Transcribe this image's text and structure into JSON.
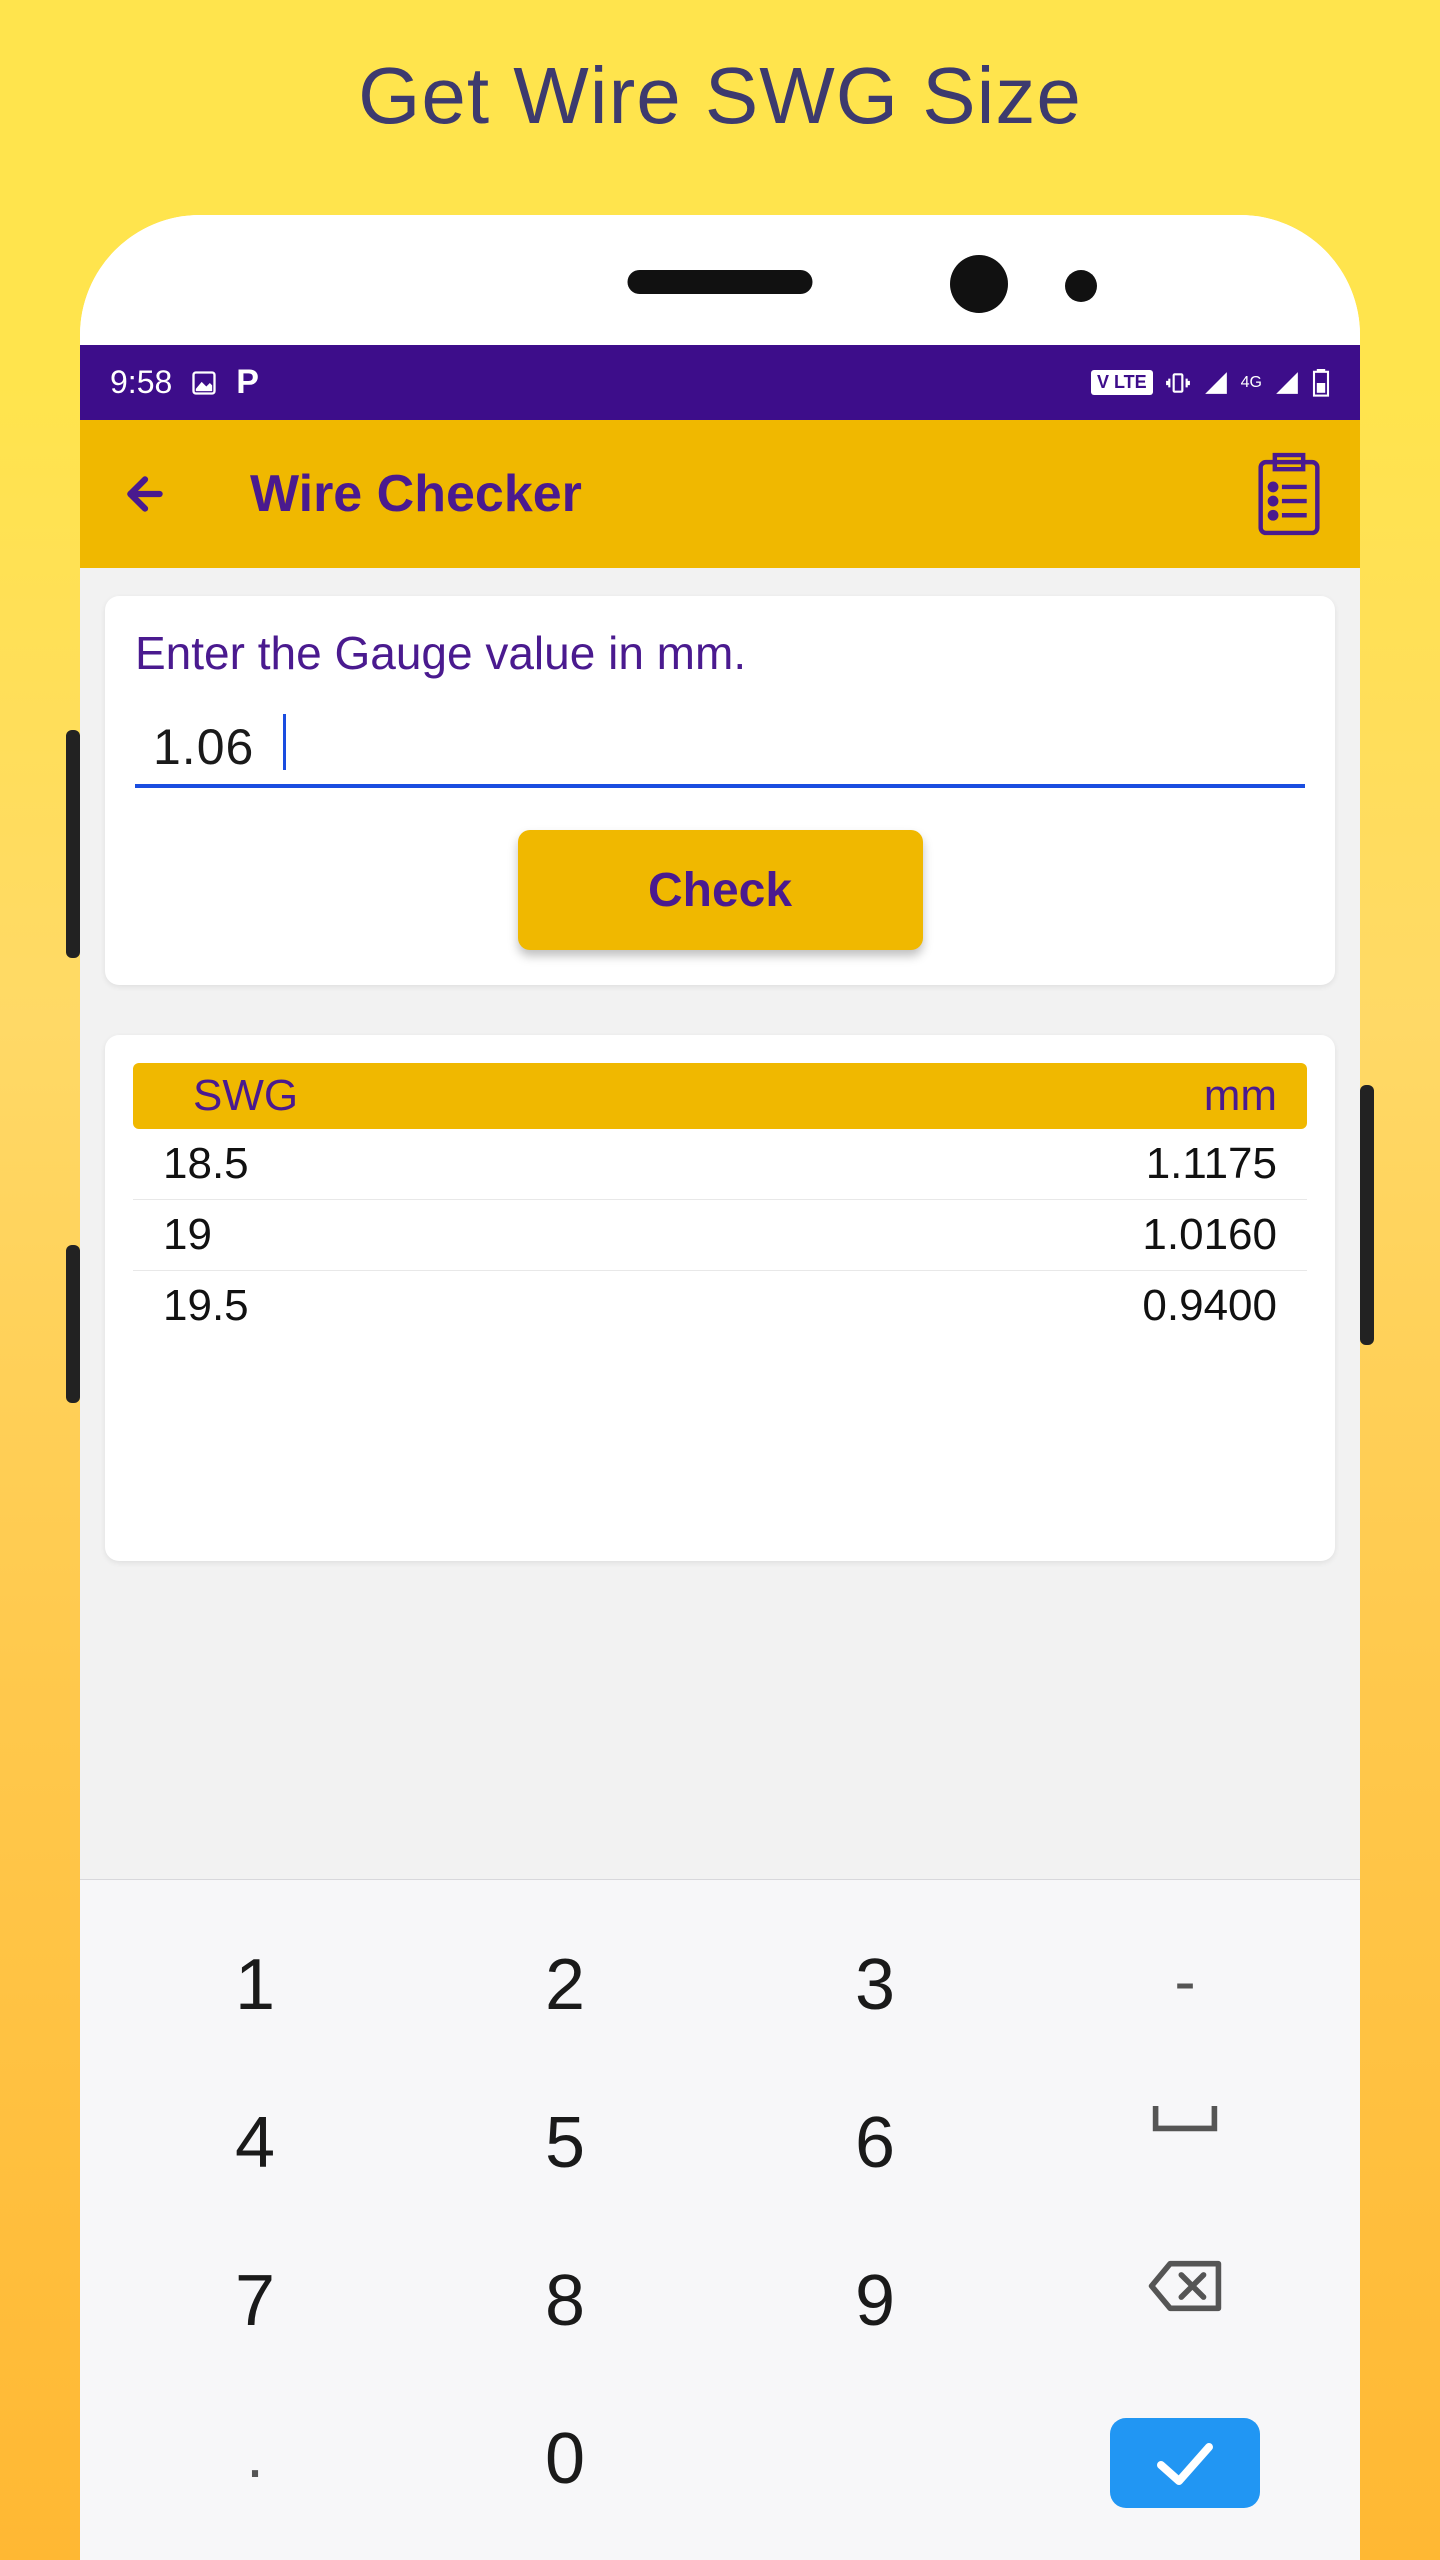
{
  "marketing_title": "Get Wire SWG Size",
  "status_bar": {
    "time": "9:58",
    "volte": "V LTE",
    "network": "4G"
  },
  "app_bar": {
    "title": "Wire Checker"
  },
  "input_card": {
    "label": "Enter the Gauge value in mm.",
    "value": "1.06",
    "check_button": "Check"
  },
  "table": {
    "header_swg": "SWG",
    "header_mm": "mm",
    "rows": [
      {
        "swg": "18.5",
        "mm": "1.1175"
      },
      {
        "swg": "19",
        "mm": "1.0160"
      },
      {
        "swg": "19.5",
        "mm": "0.9400"
      }
    ]
  },
  "keyboard": {
    "k1": "1",
    "k2": "2",
    "k3": "3",
    "kdash": "-",
    "k4": "4",
    "k5": "5",
    "k6": "6",
    "k7": "7",
    "k8": "8",
    "k9": "9",
    "k0": "0",
    "kdot": "."
  },
  "colors": {
    "accent_yellow": "#f0b800",
    "brand_purple": "#4a1a8f",
    "status_purple": "#3d0d8a",
    "input_blue": "#1a4de0",
    "enter_blue": "#2196f3"
  }
}
